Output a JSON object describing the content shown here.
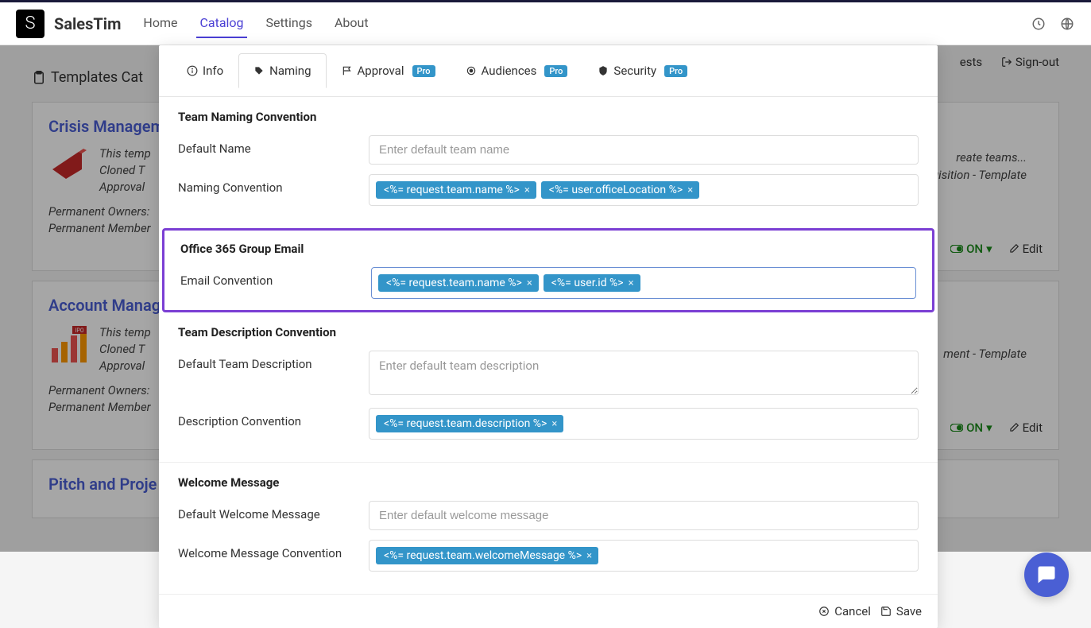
{
  "brand": "SalesTim",
  "nav": {
    "home": "Home",
    "catalog": "Catalog",
    "settings": "Settings",
    "about": "About"
  },
  "page": {
    "title_prefix": "Templates Cat",
    "top_right": {
      "ests": "ests",
      "signout": "Sign-out"
    }
  },
  "cards": [
    {
      "title": "Crisis Managemen",
      "line1": "This temp",
      "line2": "Cloned T",
      "line3": "Approval",
      "line4": "Permanent Owners:",
      "line5": "Permanent Member",
      "right1": "reate teams...",
      "right2": "uisition - Template",
      "on": "ON",
      "edit": "Edit"
    },
    {
      "title": "Account Manage",
      "line1": "This temp",
      "line2": "Cloned T",
      "line3": "Approval",
      "line4": "Permanent Owners:",
      "line5": "Permanent Member",
      "right2": "ment - Template",
      "on": "ON",
      "edit": "Edit"
    },
    {
      "title": "Pitch and Proje"
    }
  ],
  "modal": {
    "tabs": {
      "info": "Info",
      "naming": "Naming",
      "approval": "Approval",
      "audiences": "Audiences",
      "security": "Security",
      "pro": "Pro"
    },
    "team_naming": {
      "title": "Team Naming Convention",
      "default_name_label": "Default Name",
      "default_name_placeholder": "Enter default team name",
      "naming_conv_label": "Naming Convention",
      "tags": [
        "<%= request.team.name %>",
        "<%= user.officeLocation %>"
      ]
    },
    "email": {
      "title": "Office 365 Group Email",
      "label": "Email Convention",
      "tags": [
        "<%= request.team.name %>",
        "<%= user.id %>"
      ]
    },
    "desc": {
      "title": "Team Description Convention",
      "default_label": "Default Team Description",
      "default_placeholder": "Enter default team description",
      "conv_label": "Description Convention",
      "tags": [
        "<%= request.team.description %>"
      ]
    },
    "welcome": {
      "title": "Welcome Message",
      "default_label": "Default Welcome Message",
      "default_placeholder": "Enter default welcome message",
      "conv_label": "Welcome Message Convention",
      "tags": [
        "<%= request.team.welcomeMessage %>"
      ]
    },
    "footer": {
      "cancel": "Cancel",
      "save": "Save"
    }
  }
}
